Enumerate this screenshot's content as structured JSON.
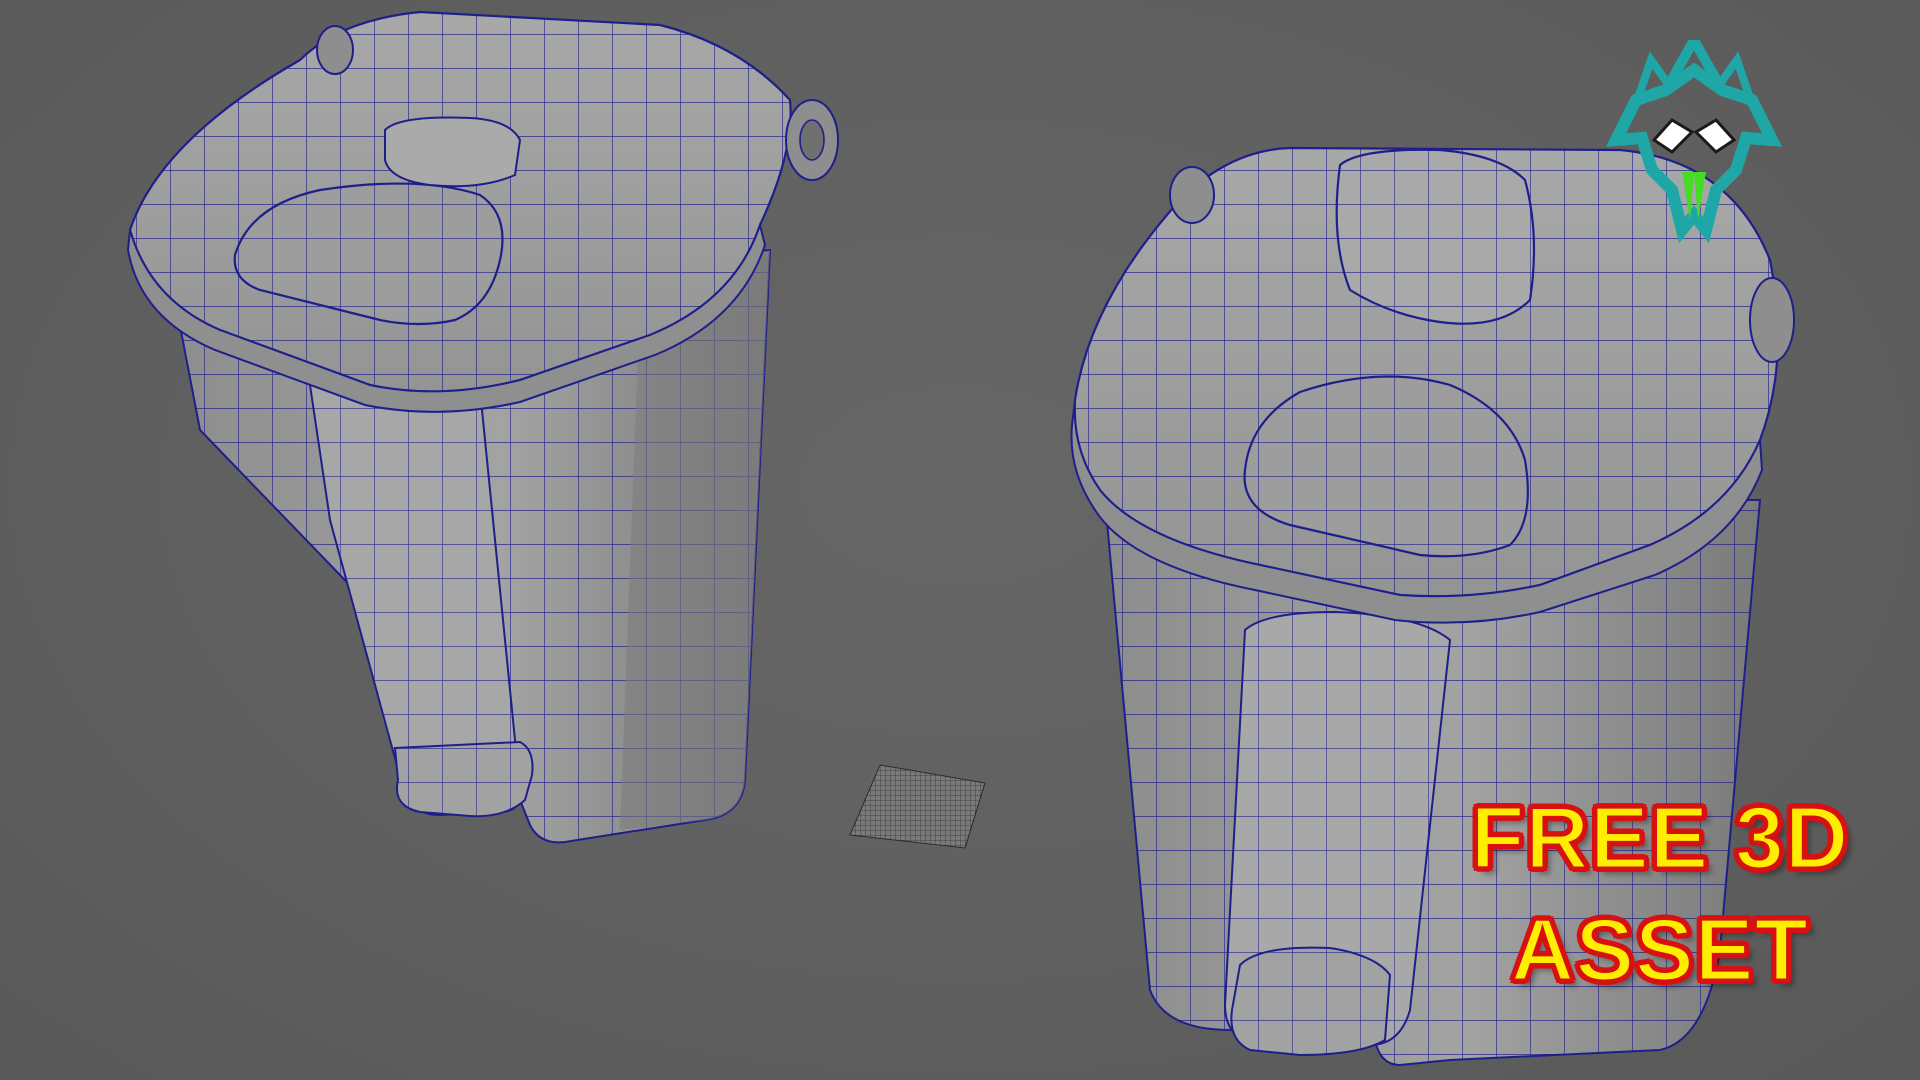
{
  "promo": {
    "line1": "FREE 3D",
    "line2": "ASSET"
  },
  "viewport": {
    "background_color": "#5f5f5f",
    "wireframe_color": "#1f1f8c",
    "surface_color": "#9a9a9a"
  },
  "logo": {
    "icon": "wolf-head-logo-icon",
    "outline_color": "#1fa7a7",
    "fang_color": "#44dd22"
  },
  "objects": [
    {
      "name": "trash-bin-left",
      "icon": "pedal-trash-bin-wireframe"
    },
    {
      "name": "grid-marker",
      "icon": "ground-grid-patch"
    },
    {
      "name": "trash-bin-right",
      "icon": "pedal-trash-bin-wireframe"
    }
  ]
}
